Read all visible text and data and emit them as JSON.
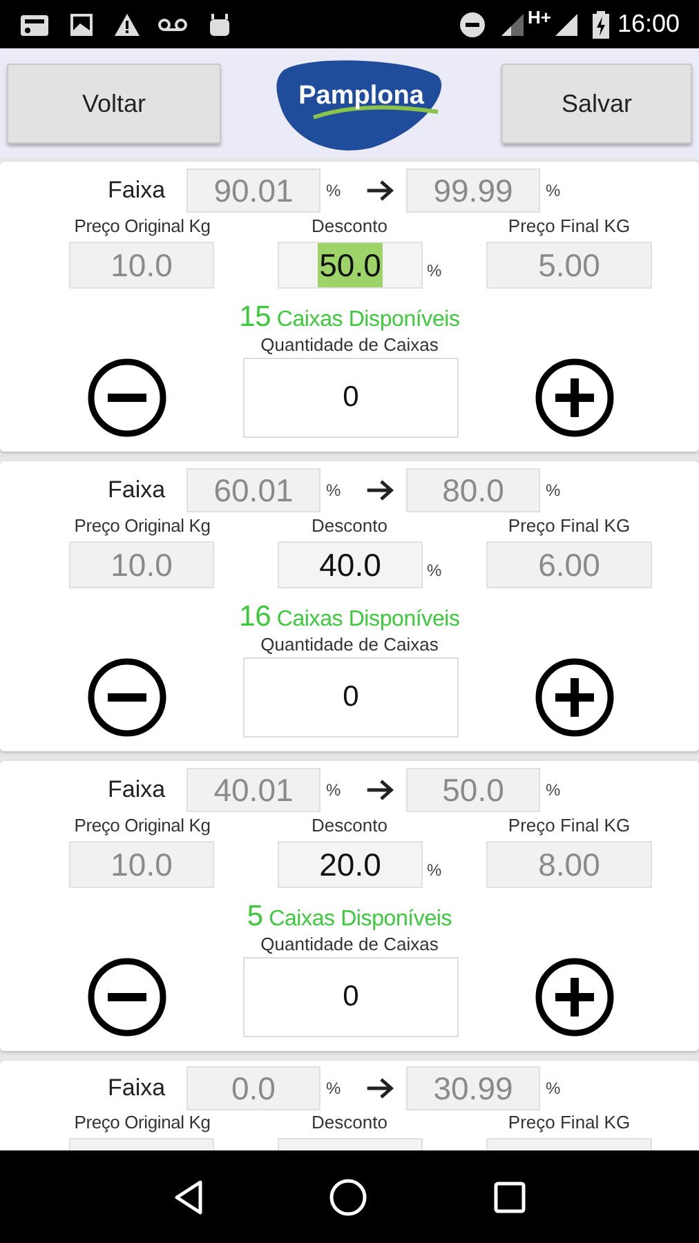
{
  "status_bar": {
    "network": "H+",
    "time": "16:00"
  },
  "header": {
    "back_button": "Voltar",
    "logo": "Pamplona",
    "save_button": "Salvar"
  },
  "tiers": [
    {
      "range_label": "Faixa",
      "range_from": "90.01",
      "range_from_unit": "%",
      "range_to": "99.99",
      "range_to_unit": "%",
      "original_price_label": "Preço Original Kg",
      "discount_label": "Desconto",
      "final_price_label": "Preço Final KG",
      "original_price": "10.0",
      "discount": "50.0",
      "discount_selected": true,
      "discount_unit": "%",
      "final_price": "5.00",
      "available_count": "15",
      "available_label": "Caixas Disponíveis",
      "quantity_label": "Quantidade de Caixas",
      "quantity": "0"
    },
    {
      "range_label": "Faixa",
      "range_from": "60.01",
      "range_from_unit": "%",
      "range_to": "80.0",
      "range_to_unit": "%",
      "original_price_label": "Preço Original Kg",
      "discount_label": "Desconto",
      "final_price_label": "Preço Final KG",
      "original_price": "10.0",
      "discount": "40.0",
      "discount_selected": false,
      "discount_unit": "%",
      "final_price": "6.00",
      "available_count": "16",
      "available_label": "Caixas Disponíveis",
      "quantity_label": "Quantidade de Caixas",
      "quantity": "0"
    },
    {
      "range_label": "Faixa",
      "range_from": "40.01",
      "range_from_unit": "%",
      "range_to": "50.0",
      "range_to_unit": "%",
      "original_price_label": "Preço Original Kg",
      "discount_label": "Desconto",
      "final_price_label": "Preço Final KG",
      "original_price": "10.0",
      "discount": "20.0",
      "discount_selected": false,
      "discount_unit": "%",
      "final_price": "8.00",
      "available_count": "5",
      "available_label": "Caixas Disponíveis",
      "quantity_label": "Quantidade de Caixas",
      "quantity": "0"
    },
    {
      "range_label": "Faixa",
      "range_from": "0.0",
      "range_from_unit": "%",
      "range_to": "30.99",
      "range_to_unit": "%",
      "original_price_label": "Preço Original Kg",
      "discount_label": "Desconto",
      "final_price_label": "Preço Final KG"
    }
  ]
}
